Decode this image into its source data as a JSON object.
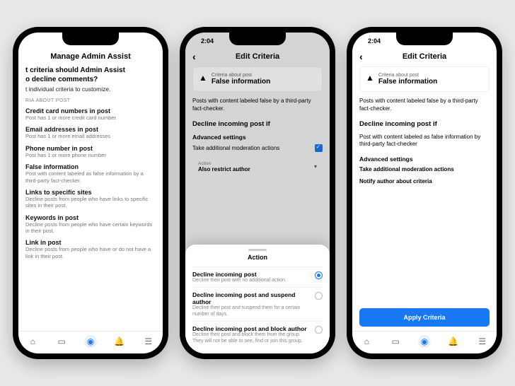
{
  "phone1": {
    "header": "Manage Admin Assist",
    "question_line1": "t criteria should Admin Assist",
    "question_line2": "o decline comments?",
    "question_sub": "t individual criteria to customize.",
    "section_label": "RIA ABOUT POST",
    "criteria": [
      {
        "title": "Credit card numbers in post",
        "desc": "Post has 1 or more credit card number"
      },
      {
        "title": "Email addresses in post",
        "desc": "Post has 1 or more email addresses"
      },
      {
        "title": "Phone number in post",
        "desc": "Post has 1 or more phone number"
      },
      {
        "title": "False information",
        "desc": "Post with content labeled as false information by a third-party fact-checker."
      },
      {
        "title": "Links to specific sites",
        "desc": "Decline posts from people who have links to specific sites in their post."
      },
      {
        "title": "Keywords in post",
        "desc": "Decline posts from people who have certain keywords in their post."
      },
      {
        "title": "Link in post",
        "desc": "Decline posts from people who have or do not have a link in their post."
      }
    ]
  },
  "phone2": {
    "time": "2:04",
    "header": "Edit Criteria",
    "card_label": "Criteria about post",
    "card_name": "False information",
    "body": "Posts with content labeled false by a third-party fact-checker.",
    "subhead": "Decline incoming post if",
    "adv_label": "Advanced settings",
    "adv_row": "Take additional moderation actions",
    "select_label": "Action",
    "select_value": "Also restrict author",
    "sheet_title": "Action",
    "options": [
      {
        "title": "Decline incoming post",
        "desc": "Decline their post with no additional action."
      },
      {
        "title": "Decline incoming post and suspend author",
        "desc": "Decline their post and suspend them for a certain number of days."
      },
      {
        "title": "Decline incoming post and block author",
        "desc": "Decline their post and block them from the group. They will not be able to see, find or join this group."
      }
    ]
  },
  "phone3": {
    "time": "2:04",
    "header": "Edit Criteria",
    "card_label": "Criteria about post",
    "card_name": "False information",
    "body": "Posts with content labeled false by a third-party fact-checker.",
    "subhead": "Decline incoming post if",
    "rule": "Post with content labeled as false information by third-party fact-checker",
    "adv_label": "Advanced settings",
    "adv1": "Take additional moderation actions",
    "adv2": "Notify author about criteria",
    "apply": "Apply Criteria"
  }
}
